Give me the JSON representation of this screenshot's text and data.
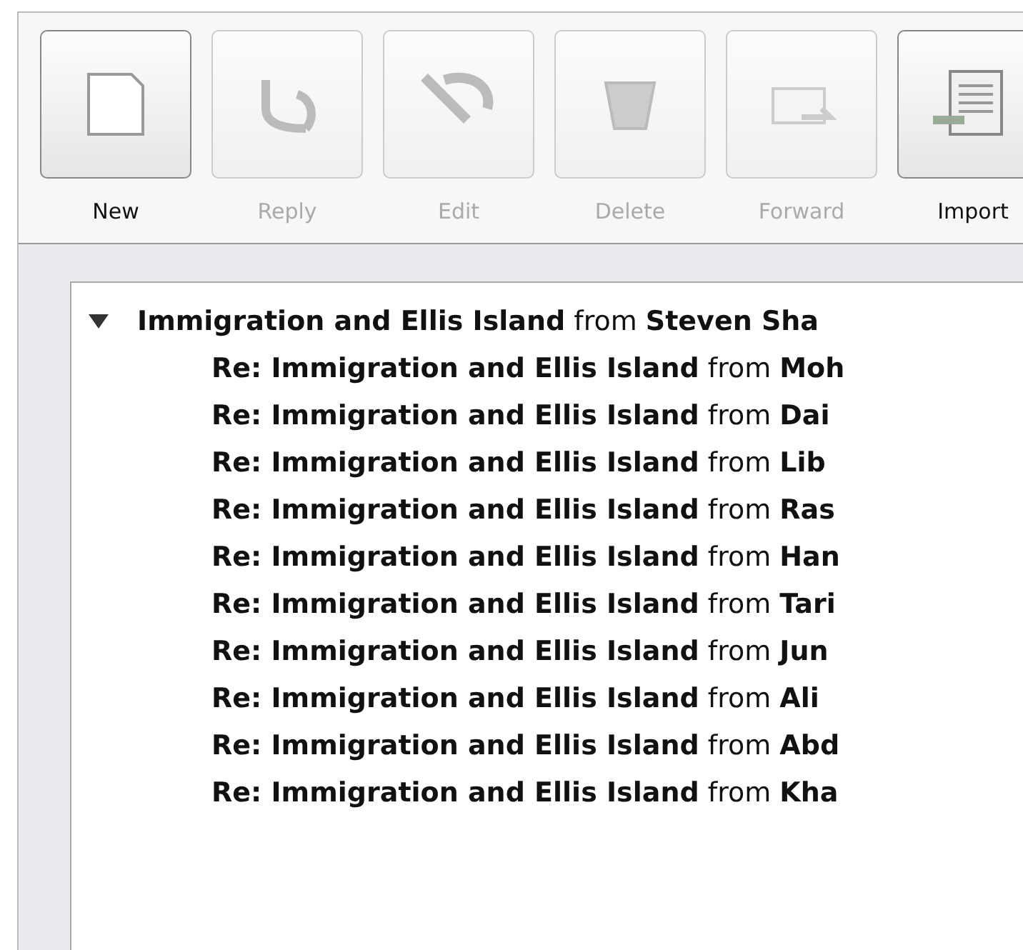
{
  "toolbar": [
    {
      "label": "New",
      "kind": "new",
      "disabled": false
    },
    {
      "label": "Reply",
      "kind": "reply",
      "disabled": true
    },
    {
      "label": "Edit",
      "kind": "edit",
      "disabled": true
    },
    {
      "label": "Delete",
      "kind": "delete",
      "disabled": true
    },
    {
      "label": "Forward",
      "kind": "forward",
      "disabled": true
    },
    {
      "label": "Import",
      "kind": "import",
      "disabled": false
    }
  ],
  "threads": [
    {
      "title": "**Immigration and Ellis Island** from **Steven Sha**",
      "expanded": true,
      "children": [
        {
          "title": "**Re: Immigration and Ellis Island** from **Moh**"
        },
        {
          "title": "**Re: Immigration and Ellis Island** from **Dai**"
        },
        {
          "title": "**Re: Immigration and Ellis Island** from **Lib**"
        },
        {
          "title": "**Re: Immigration and Ellis Island** from **Ras**"
        },
        {
          "title": "**Re: Immigration and Ellis Island** from **Han**"
        },
        {
          "title": "**Re: Immigration and Ellis Island** from **Tari**"
        },
        {
          "title": "**Re: Immigration and Ellis Island** from **Jun**"
        },
        {
          "title": "**Re: Immigration and Ellis Island** from **Ali**"
        },
        {
          "title": "**Re: Immigration and Ellis Island** from **Abd**"
        },
        {
          "title": "**Re: Immigration and Ellis Island** from **Kha**"
        }
      ]
    }
  ]
}
